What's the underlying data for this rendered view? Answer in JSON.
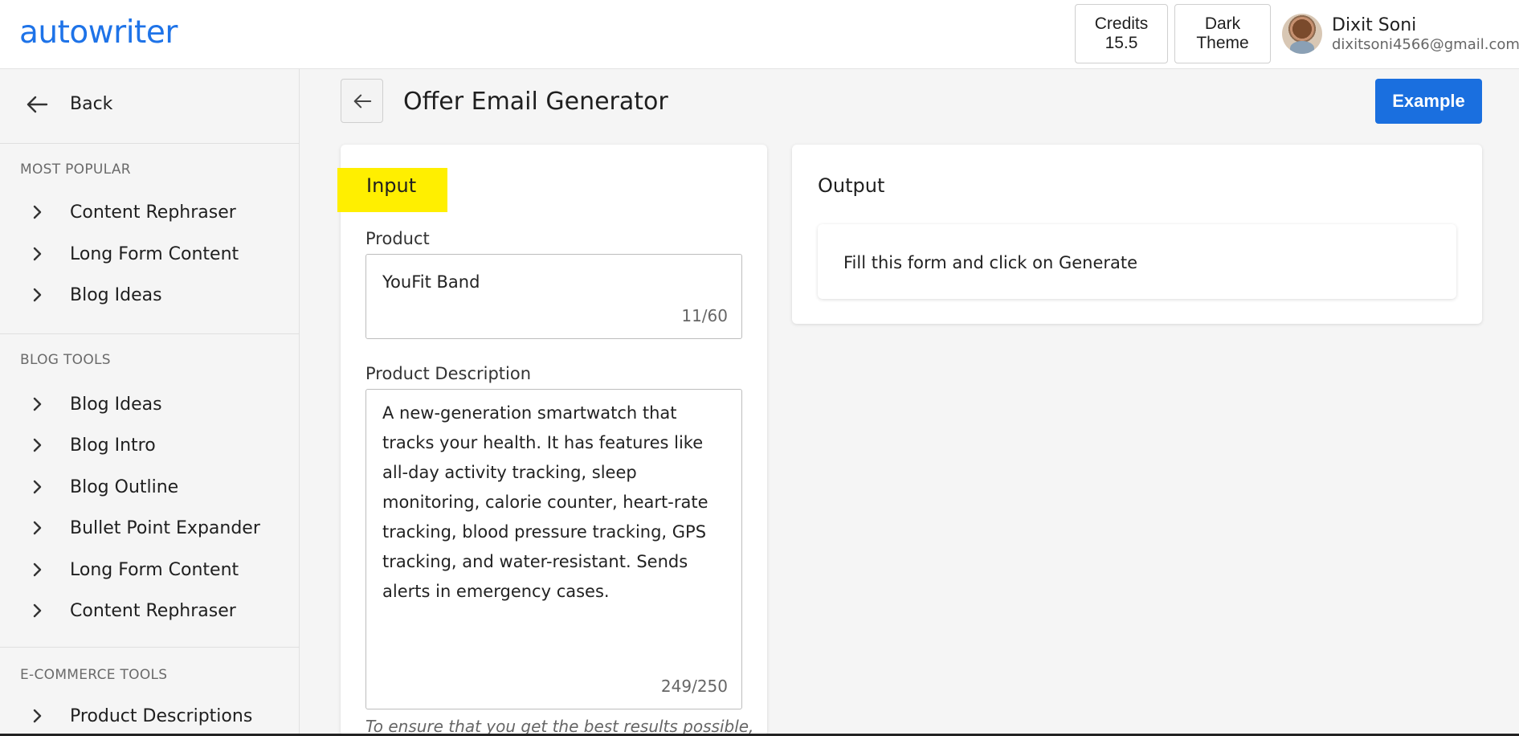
{
  "brand": {
    "logo": "autowriter"
  },
  "topbar": {
    "credits_label": "Credits",
    "credits_value": "15.5",
    "theme_line1": "Dark",
    "theme_line2": "Theme",
    "user_name": "Dixit Soni",
    "user_email": "dixitsoni4566@gmail.com"
  },
  "sidebar": {
    "back_label": "Back",
    "sections": [
      {
        "title": "MOST POPULAR",
        "items": [
          "Content Rephraser",
          "Long Form Content",
          "Blog Ideas"
        ]
      },
      {
        "title": "BLOG TOOLS",
        "items": [
          "Blog Ideas",
          "Blog Intro",
          "Blog Outline",
          "Bullet Point Expander",
          "Long Form Content",
          "Content Rephraser"
        ]
      },
      {
        "title": "E-COMMERCE TOOLS",
        "items": [
          "Product Descriptions"
        ]
      }
    ]
  },
  "main": {
    "title": "Offer Email Generator",
    "example_label": "Example",
    "input": {
      "heading": "Input",
      "product_label": "Product",
      "product_value": "YouFit Band",
      "product_count": "11/60",
      "description_label": "Product Description",
      "description_value": "A new-generation smartwatch that tracks your health. It has features like all-day activity tracking, sleep monitoring, calorie counter, heart-rate tracking, blood pressure tracking, GPS tracking, and water-resistant. Sends alerts in emergency cases.",
      "description_count": "249/250",
      "hint": "To ensure that you get the best results possible,"
    },
    "output": {
      "heading": "Output",
      "placeholder": "Fill this form and click on Generate"
    }
  },
  "colors": {
    "accent": "#1a6fdf",
    "highlight": "#ffef00",
    "logo": "#1e73e8"
  }
}
